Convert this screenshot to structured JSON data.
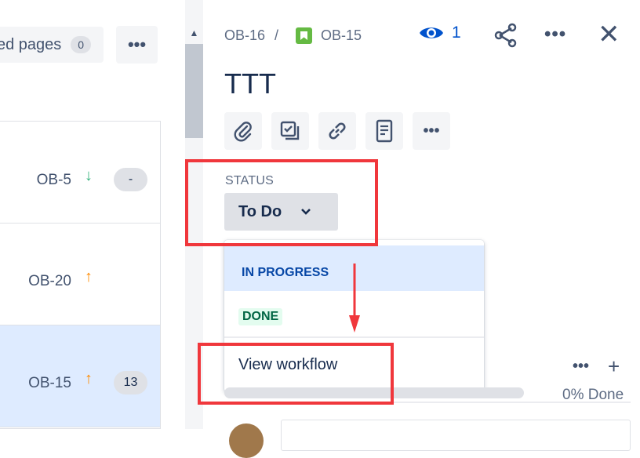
{
  "left_panel": {
    "linked_pages_label": "ed pages",
    "linked_pages_count": "0",
    "more_label": "•••",
    "rows": [
      {
        "key": "OB-5",
        "priority": "↓",
        "priority_color": "#36b37e",
        "badge": "-"
      },
      {
        "key": "OB-20",
        "priority": "↑",
        "priority_color": "#ff8b00",
        "badge": ""
      },
      {
        "key": "OB-15",
        "priority": "↑",
        "priority_color": "#ff8b00",
        "badge": "13"
      }
    ]
  },
  "scrollbar": {
    "up_arrow": "▲"
  },
  "issue": {
    "breadcrumb_parent": "OB-16",
    "breadcrumb_sep": "/",
    "breadcrumb_current": "OB-15",
    "watchers_count": "1",
    "more_label": "•••",
    "close_label": "✕",
    "title": "TTT"
  },
  "toolbar": {
    "icons": [
      "attachment-icon",
      "subtask-icon",
      "link-icon",
      "page-icon",
      "more-icon"
    ],
    "more_label": "•••"
  },
  "status": {
    "label": "STATUS",
    "current": "To Do",
    "chevron": "⌄",
    "options": [
      {
        "label": "IN PROGRESS",
        "highlighted": true
      },
      {
        "label": "DONE",
        "highlighted": false
      }
    ],
    "view_workflow": "View workflow"
  },
  "child_issues": {
    "more_label": "•••",
    "add_label": "+",
    "progress_text": "0% Done",
    "progress_fraction": 0
  },
  "colors": {
    "accent": "#0052cc",
    "story_green": "#65ba43",
    "annotation_red": "#f0373c",
    "selected_row": "#deebff"
  }
}
